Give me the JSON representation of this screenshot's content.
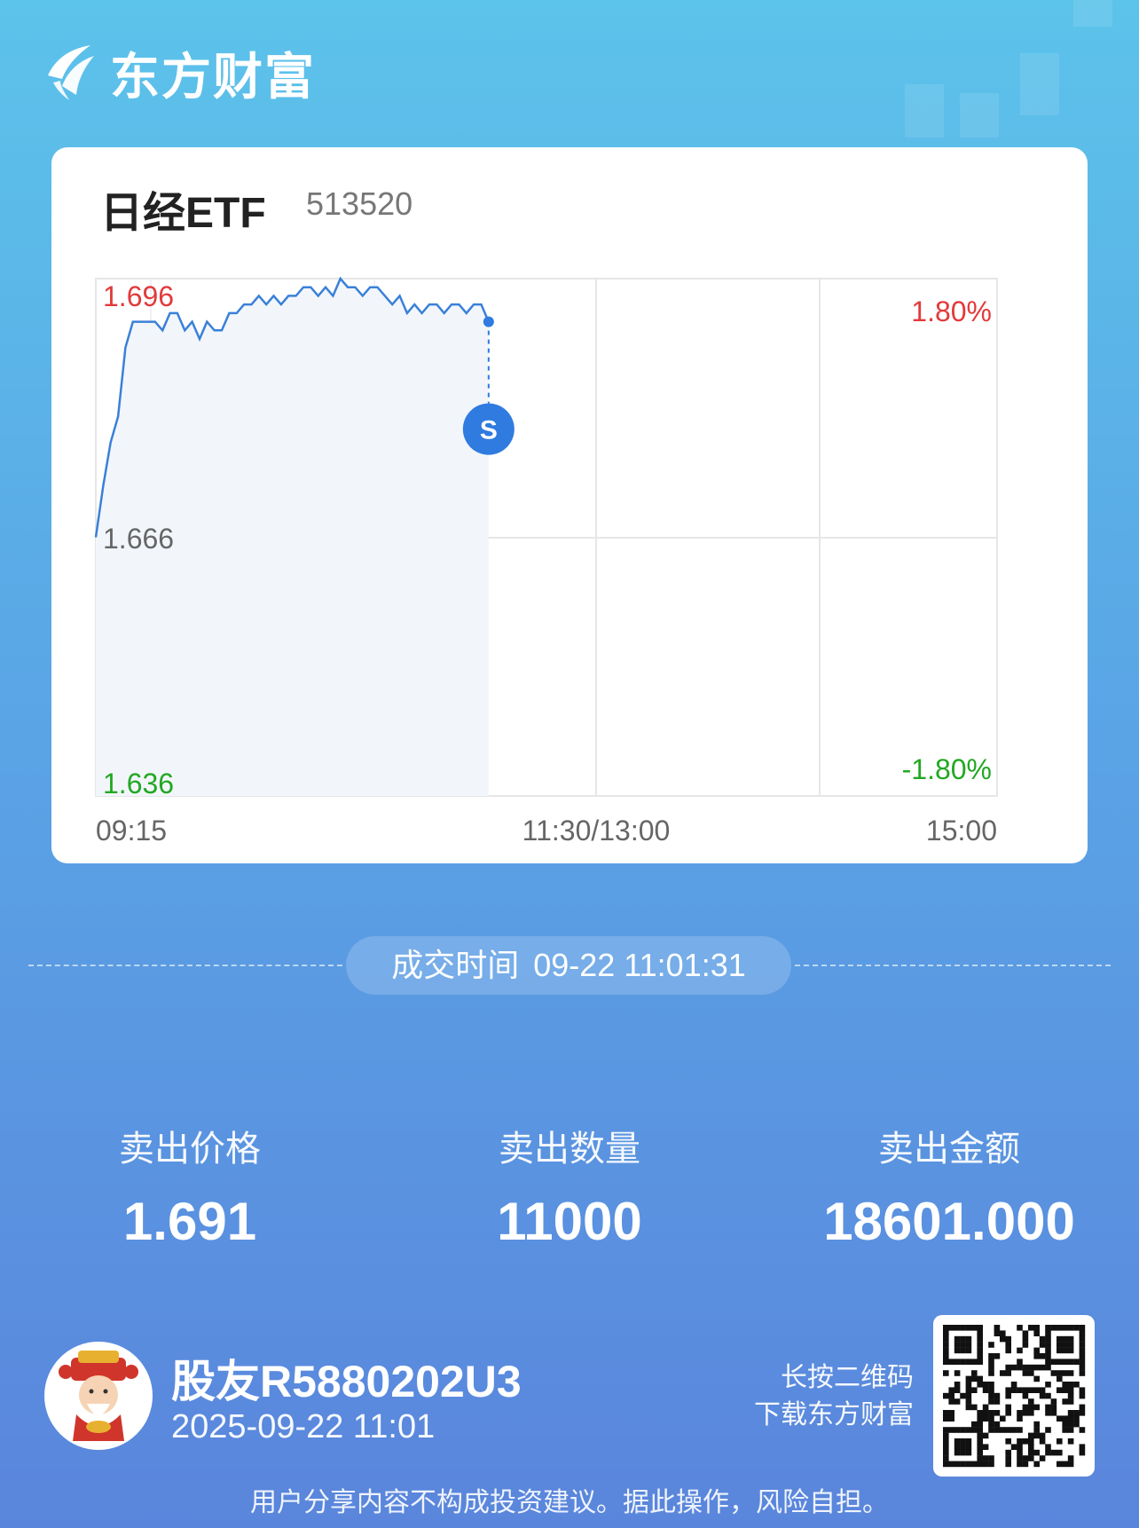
{
  "brand": {
    "name": "东方财富"
  },
  "stock": {
    "name": "日经ETF",
    "code": "513520"
  },
  "chart_data": {
    "type": "line",
    "title": "",
    "prices": {
      "high": "1.696",
      "mid": "1.666",
      "low": "1.636"
    },
    "percents": {
      "high": "1.80%",
      "low": "-1.80%"
    },
    "x_labels": [
      "09:15",
      "11:30/13:00",
      "15:00"
    ],
    "ylim": [
      1.636,
      1.696
    ],
    "x": [
      "09:15",
      "09:17",
      "09:19",
      "09:21",
      "09:23",
      "09:25",
      "09:27",
      "09:29",
      "09:31",
      "09:33",
      "09:35",
      "09:37",
      "09:39",
      "09:41",
      "09:43",
      "09:45",
      "09:47",
      "09:49",
      "09:51",
      "09:53",
      "09:55",
      "09:57",
      "09:59",
      "10:01",
      "10:03",
      "10:05",
      "10:07",
      "10:09",
      "10:11",
      "10:13",
      "10:15",
      "10:17",
      "10:19",
      "10:21",
      "10:23",
      "10:25",
      "10:27",
      "10:29",
      "10:31",
      "10:33",
      "10:35",
      "10:37",
      "10:39",
      "10:41",
      "10:43",
      "10:45",
      "10:47",
      "10:49",
      "10:51",
      "10:53",
      "10:55",
      "10:57",
      "10:59",
      "11:01"
    ],
    "series": [
      {
        "values": [
          1.666,
          1.672,
          1.677,
          1.68,
          1.688,
          1.691,
          1.691,
          1.691,
          1.691,
          1.69,
          1.692,
          1.692,
          1.69,
          1.691,
          1.689,
          1.691,
          1.69,
          1.69,
          1.692,
          1.692,
          1.693,
          1.693,
          1.694,
          1.693,
          1.694,
          1.693,
          1.694,
          1.694,
          1.695,
          1.695,
          1.694,
          1.695,
          1.694,
          1.696,
          1.695,
          1.695,
          1.694,
          1.695,
          1.695,
          1.694,
          1.693,
          1.694,
          1.692,
          1.693,
          1.692,
          1.693,
          1.693,
          1.692,
          1.693,
          1.693,
          1.692,
          1.693,
          1.693,
          1.691
        ]
      }
    ],
    "marker": {
      "label": "S",
      "time": "11:01",
      "price": 1.691,
      "color": "#2f7be0"
    },
    "line_color": "#3a80d8",
    "up_color": "#e23a3a",
    "down_color": "#22a822"
  },
  "trade": {
    "time_label": "成交时间",
    "time_value": "09-22 11:01:31"
  },
  "stats": [
    {
      "label": "卖出价格",
      "value": "1.691"
    },
    {
      "label": "卖出数量",
      "value": "11000"
    },
    {
      "label": "卖出金额",
      "value": "18601.000"
    }
  ],
  "user": {
    "name": "股友R5880202U3",
    "date": "2025-09-22 11:01",
    "avatar_icon": "god-of-wealth-avatar-icon"
  },
  "qr": {
    "hint_line1": "长按二维码",
    "hint_line2": "下载东方财富",
    "icon": "qr-code-icon"
  },
  "disclaimer": "用户分享内容不构成投资建议。据此操作，风险自担。"
}
